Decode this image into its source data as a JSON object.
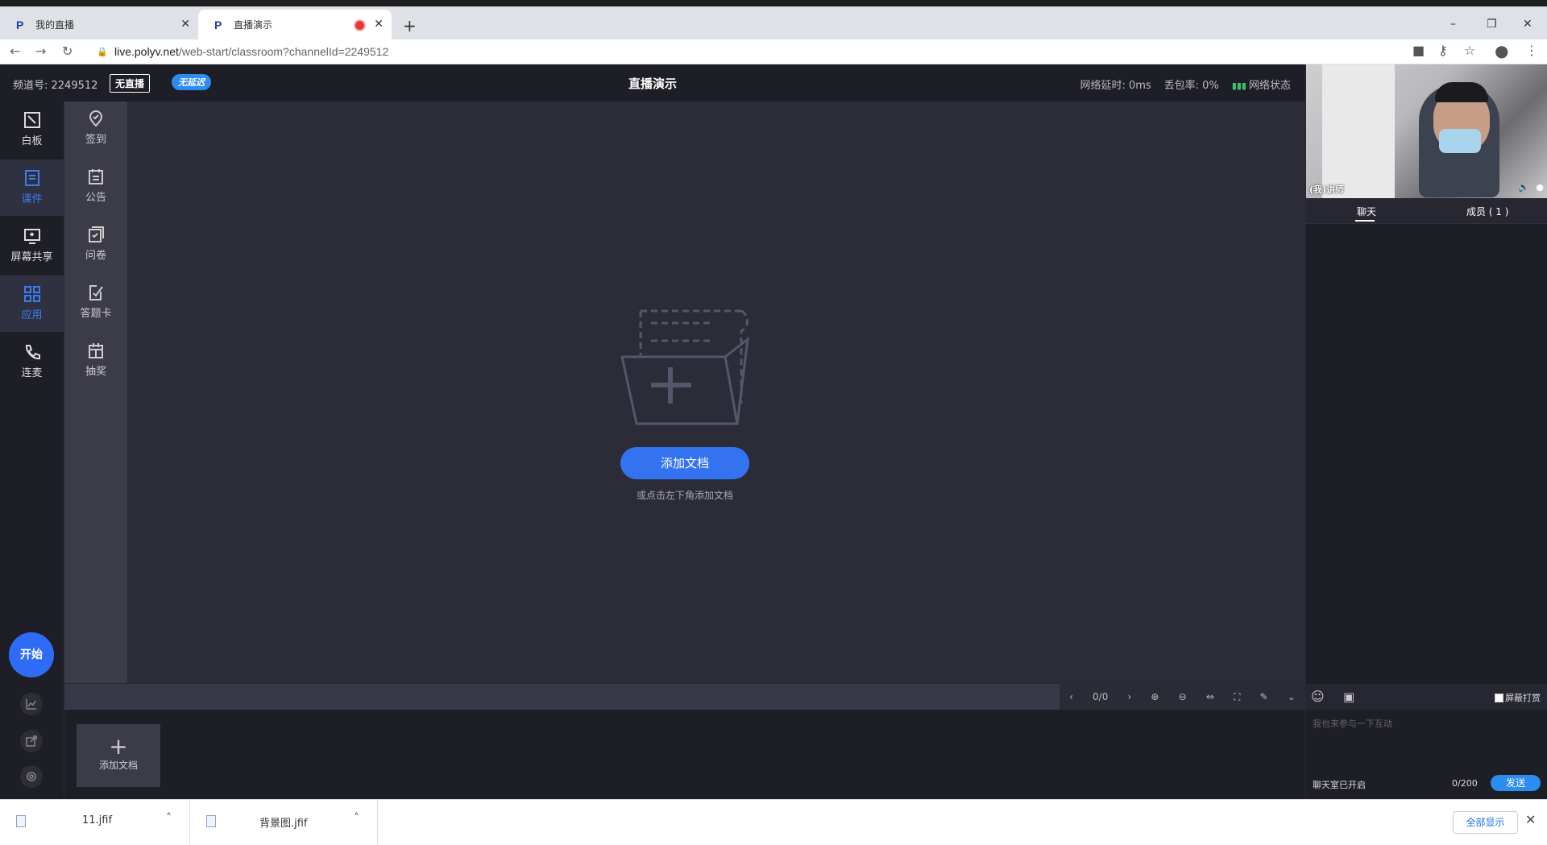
{
  "browser": {
    "tabs": [
      {
        "label": "我的直播",
        "favicon": "P"
      },
      {
        "label": "直播演示",
        "favicon": "P",
        "recording": true
      }
    ],
    "url_host": "live.polyv.net",
    "url_path": "/web-start/classroom?channelId=2249512",
    "window_controls": [
      "–",
      "❐",
      "✕"
    ]
  },
  "header": {
    "channel": "频道号: 2249512",
    "live_badge": "无直播",
    "delay_badge": "无延迟",
    "title": "直播演示",
    "latency": "网络延时: 0ms",
    "packet_loss": "丢包率: 0%",
    "net_status": "网络状态"
  },
  "leftnav": {
    "items": [
      {
        "label": "白板",
        "icon": "whiteboard-icon"
      },
      {
        "label": "课件",
        "icon": "courseware-icon",
        "selected": true
      },
      {
        "label": "屏幕共享",
        "icon": "screen-share-icon"
      },
      {
        "label": "应用",
        "icon": "apps-icon",
        "selected": true
      },
      {
        "label": "连麦",
        "icon": "phone-icon"
      }
    ],
    "start_label": "开始"
  },
  "subnav": {
    "items": [
      {
        "label": "签到",
        "icon": "checkin-icon"
      },
      {
        "label": "公告",
        "icon": "announcement-icon"
      },
      {
        "label": "问卷",
        "icon": "questionnaire-icon"
      },
      {
        "label": "答题卡",
        "icon": "answer-card-icon"
      },
      {
        "label": "抽奖",
        "icon": "lottery-icon"
      }
    ]
  },
  "canvas": {
    "add_button": "添加文档",
    "hint": "或点击左下角添加文档"
  },
  "toolbar": {
    "page": "0/0"
  },
  "thumbs": {
    "add_label": "添加文档"
  },
  "right": {
    "teacher_label": "(我)讲师",
    "tab_chat": "聊天",
    "tab_members": "成员 ( 1 )",
    "block_reward": "屏蔽打赏",
    "input_placeholder": "我也来参与一下互动",
    "chat_status": "聊天室已开启",
    "char_count": "0/200",
    "send": "发送"
  },
  "downloads": {
    "files": [
      "11.jfif",
      "背景图.jfif"
    ],
    "show_all": "全部显示"
  },
  "colors": {
    "accent": "#3473f0",
    "dark_bg": "#1d1e26",
    "canvas_bg": "#2b2c37"
  }
}
